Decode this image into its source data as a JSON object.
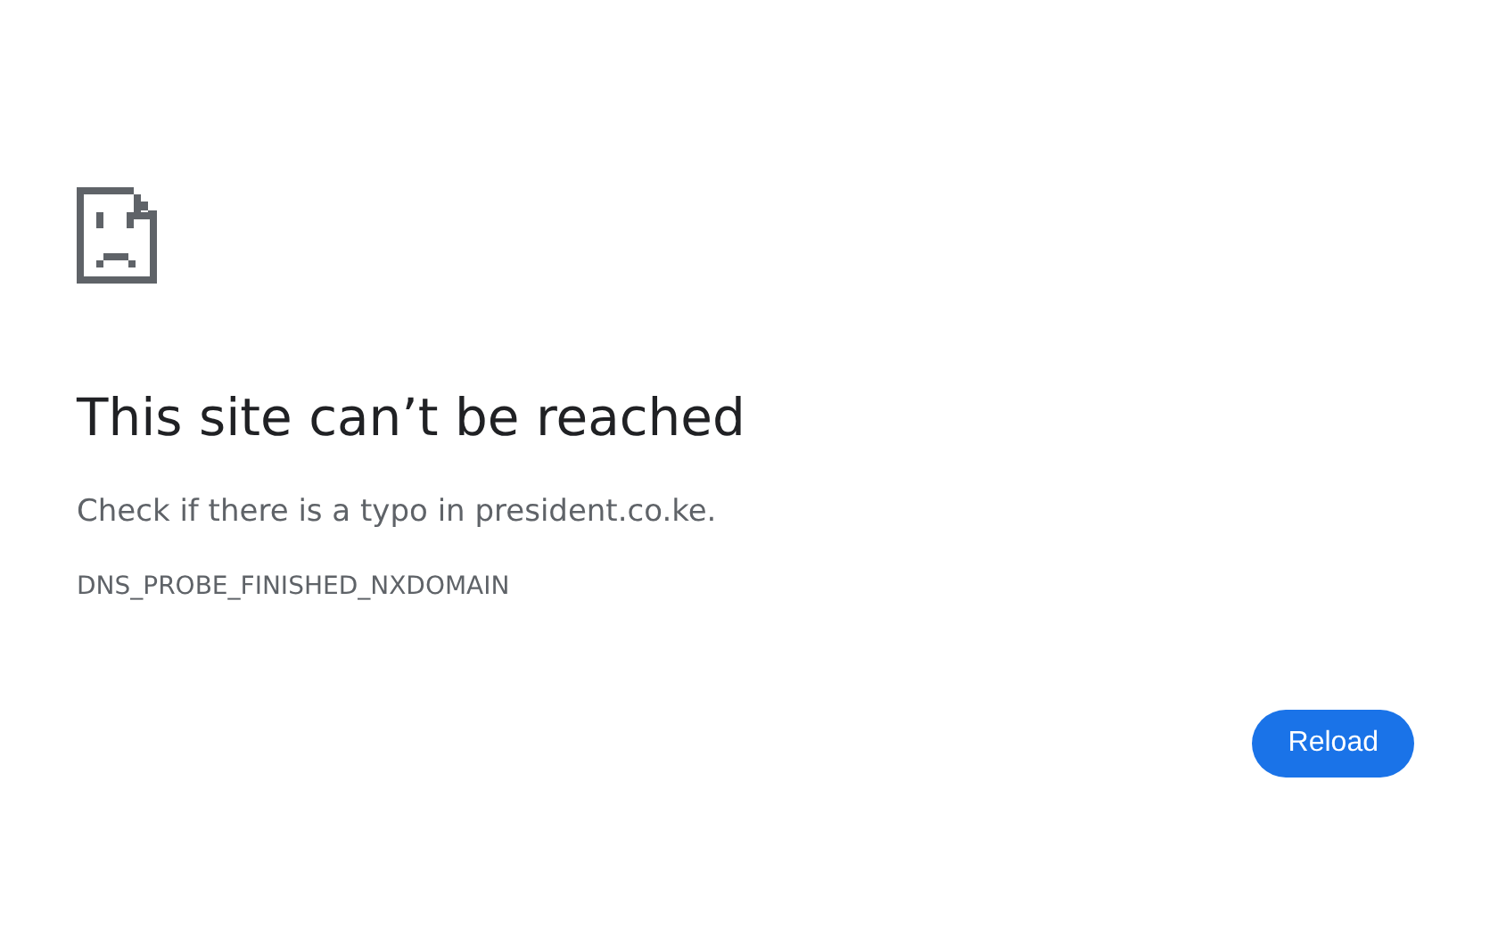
{
  "title": "This site can’t be reached",
  "message": "Check if there is a typo in president.co.ke.",
  "error_code": "DNS_PROBE_FINISHED_NXDOMAIN",
  "buttons": [
    "Reload"
  ]
}
